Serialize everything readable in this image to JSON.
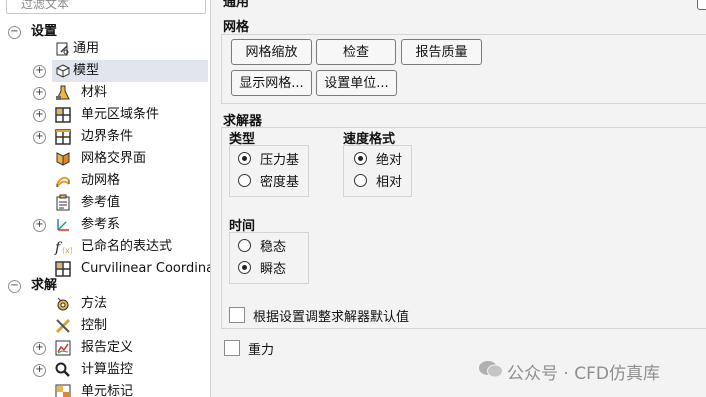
{
  "tree": {
    "filter_placeholder": "过滤文本",
    "items": [
      {
        "label": "设置",
        "bold": true
      },
      {
        "label": "通用"
      },
      {
        "label": "模型"
      },
      {
        "label": "材料"
      },
      {
        "label": "单元区域条件"
      },
      {
        "label": "边界条件"
      },
      {
        "label": "网格交界面"
      },
      {
        "label": "动网格"
      },
      {
        "label": "参考值"
      },
      {
        "label": "参考系"
      },
      {
        "label": "已命名的表达式"
      },
      {
        "label": "Curvilinear Coordina"
      },
      {
        "label": "求解",
        "bold": true
      },
      {
        "label": "方法"
      },
      {
        "label": "控制"
      },
      {
        "label": "报告定义"
      },
      {
        "label": "计算监控"
      },
      {
        "label": "单元标记"
      }
    ]
  },
  "panel": {
    "header_title": "通用",
    "mesh": {
      "title": "网格",
      "buttons": [
        "网格缩放",
        "检查",
        "报告质量",
        "显示网格...",
        "设置单位..."
      ]
    },
    "solver": {
      "title": "求解器",
      "type": {
        "title": "类型",
        "options": [
          "压力基",
          "密度基"
        ],
        "selected": "压力基"
      },
      "velocity": {
        "title": "速度格式",
        "options": [
          "绝对",
          "相对"
        ],
        "selected": "绝对"
      },
      "time": {
        "title": "时间",
        "options": [
          "稳态",
          "瞬态"
        ],
        "selected": "瞬态"
      },
      "adjust_defaults_label": "根据设置调整求解器默认值"
    },
    "gravity_label": "重力"
  },
  "watermark": "公众号 · CFD仿真库"
}
